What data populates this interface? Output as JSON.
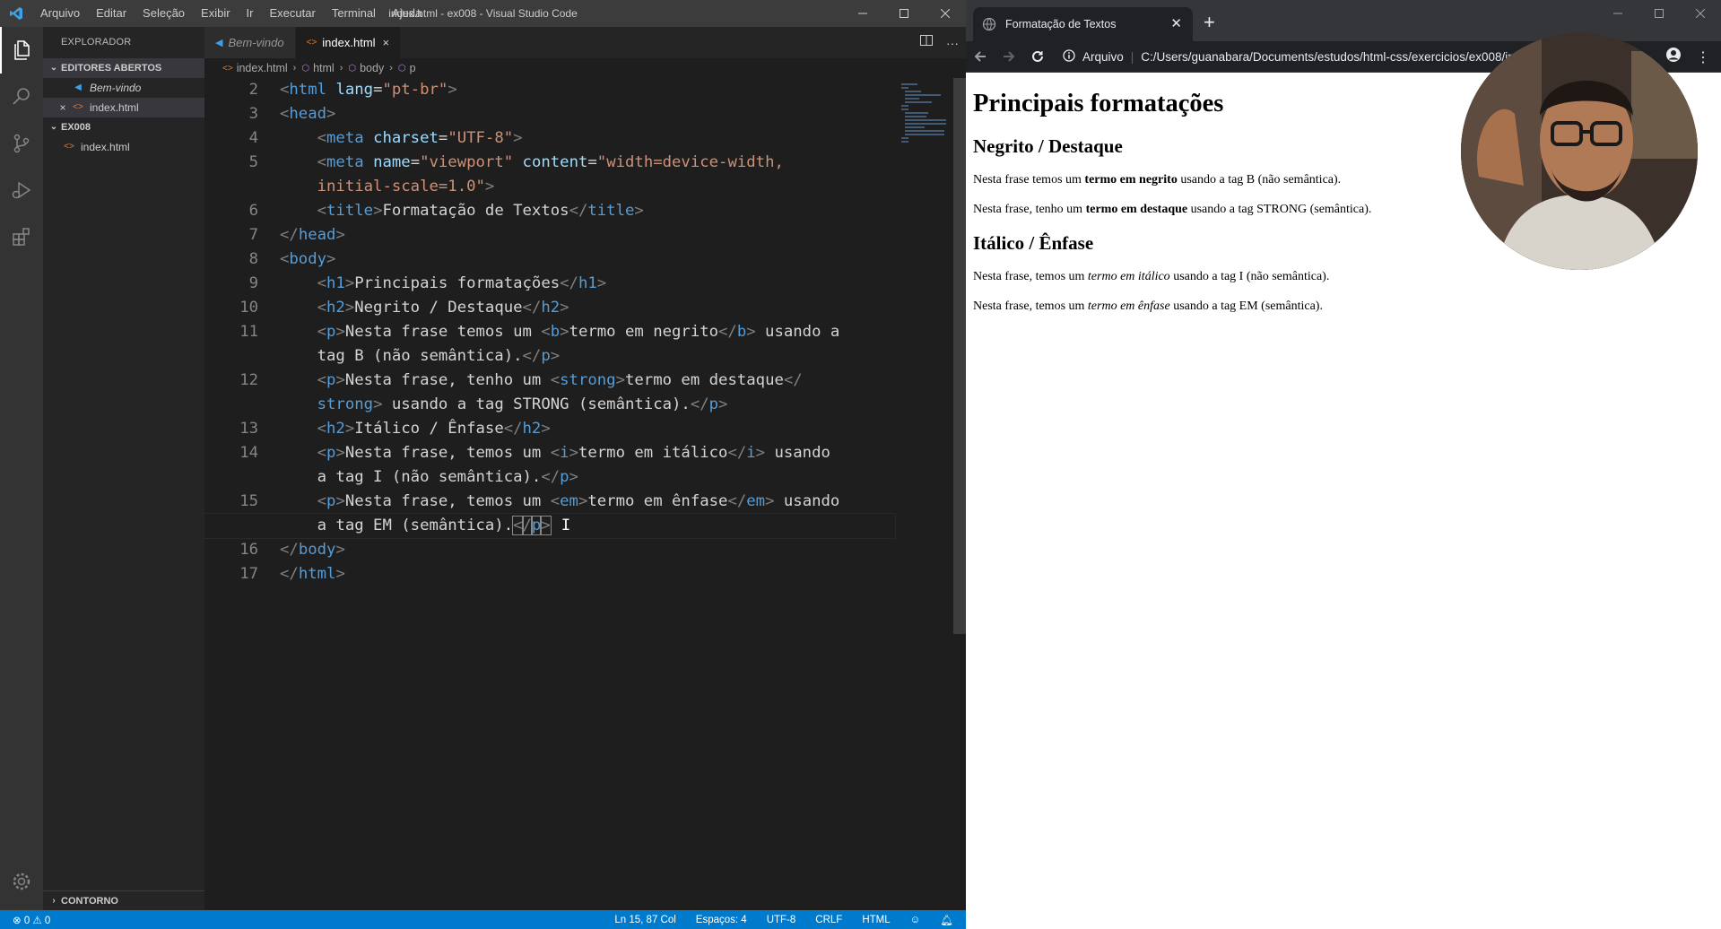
{
  "vscode": {
    "menu": [
      "Arquivo",
      "Editar",
      "Seleção",
      "Exibir",
      "Ir",
      "Executar",
      "Terminal",
      "Ajuda"
    ],
    "window_title": "index.html - ex008 - Visual Studio Code",
    "sidebar": {
      "title": "EXPLORADOR",
      "open_editors_label": "EDITORES ABERTOS",
      "open_editors": [
        {
          "label": "Bem-vindo",
          "icon": "vscode-icon"
        },
        {
          "label": "index.html",
          "icon": "html-file-icon",
          "close": "×"
        }
      ],
      "folder_label": "EX008",
      "folder_files": [
        "index.html"
      ],
      "outline_label": "CONTORNO"
    },
    "tabs": [
      {
        "label": "Bem-vindo",
        "active": false
      },
      {
        "label": "index.html",
        "active": true,
        "close": "×"
      }
    ],
    "breadcrumb": [
      "index.html",
      "html",
      "body",
      "p"
    ],
    "code_lines": [
      {
        "n": "2",
        "parts": [
          [
            "t",
            "<"
          ],
          [
            "tag",
            "html"
          ],
          [
            "txt",
            " "
          ],
          [
            "attr",
            "lang"
          ],
          [
            "txt",
            "="
          ],
          [
            "str",
            "\"pt-br\""
          ],
          [
            "t",
            ">"
          ]
        ]
      },
      {
        "n": "3",
        "parts": [
          [
            "t",
            "<"
          ],
          [
            "tag",
            "head"
          ],
          [
            "t",
            ">"
          ]
        ]
      },
      {
        "n": "4",
        "parts": [
          [
            "txt",
            "    "
          ],
          [
            "t",
            "<"
          ],
          [
            "tag",
            "meta"
          ],
          [
            "txt",
            " "
          ],
          [
            "attr",
            "charset"
          ],
          [
            "txt",
            "="
          ],
          [
            "str",
            "\"UTF-8\""
          ],
          [
            "t",
            ">"
          ]
        ]
      },
      {
        "n": "5",
        "parts": [
          [
            "txt",
            "    "
          ],
          [
            "t",
            "<"
          ],
          [
            "tag",
            "meta"
          ],
          [
            "txt",
            " "
          ],
          [
            "attr",
            "name"
          ],
          [
            "txt",
            "="
          ],
          [
            "str",
            "\"viewport\""
          ],
          [
            "txt",
            " "
          ],
          [
            "attr",
            "content"
          ],
          [
            "txt",
            "="
          ],
          [
            "str",
            "\"width=device-width,"
          ]
        ]
      },
      {
        "n": "",
        "parts": [
          [
            "txt",
            "    "
          ],
          [
            "str",
            "initial-scale=1.0\""
          ],
          [
            "t",
            ">"
          ]
        ]
      },
      {
        "n": "6",
        "parts": [
          [
            "txt",
            "    "
          ],
          [
            "t",
            "<"
          ],
          [
            "tag",
            "title"
          ],
          [
            "t",
            ">"
          ],
          [
            "txt",
            "Formatação de Textos"
          ],
          [
            "t",
            "</"
          ],
          [
            "tag",
            "title"
          ],
          [
            "t",
            ">"
          ]
        ]
      },
      {
        "n": "7",
        "parts": [
          [
            "t",
            "</"
          ],
          [
            "tag",
            "head"
          ],
          [
            "t",
            ">"
          ]
        ]
      },
      {
        "n": "8",
        "parts": [
          [
            "t",
            "<"
          ],
          [
            "tag",
            "body"
          ],
          [
            "t",
            ">"
          ]
        ]
      },
      {
        "n": "9",
        "parts": [
          [
            "txt",
            "    "
          ],
          [
            "t",
            "<"
          ],
          [
            "tag",
            "h1"
          ],
          [
            "t",
            ">"
          ],
          [
            "txt",
            "Principais formatações"
          ],
          [
            "t",
            "</"
          ],
          [
            "tag",
            "h1"
          ],
          [
            "t",
            ">"
          ]
        ]
      },
      {
        "n": "10",
        "parts": [
          [
            "txt",
            "    "
          ],
          [
            "t",
            "<"
          ],
          [
            "tag",
            "h2"
          ],
          [
            "t",
            ">"
          ],
          [
            "txt",
            "Negrito / Destaque"
          ],
          [
            "t",
            "</"
          ],
          [
            "tag",
            "h2"
          ],
          [
            "t",
            ">"
          ]
        ]
      },
      {
        "n": "11",
        "parts": [
          [
            "txt",
            "    "
          ],
          [
            "t",
            "<"
          ],
          [
            "tag",
            "p"
          ],
          [
            "t",
            ">"
          ],
          [
            "txt",
            "Nesta frase temos um "
          ],
          [
            "t",
            "<"
          ],
          [
            "tag",
            "b"
          ],
          [
            "t",
            ">"
          ],
          [
            "txt",
            "termo em negrito"
          ],
          [
            "t",
            "</"
          ],
          [
            "tag",
            "b"
          ],
          [
            "t",
            ">"
          ],
          [
            "txt",
            " usando a"
          ]
        ]
      },
      {
        "n": "",
        "parts": [
          [
            "txt",
            "    tag B (não semântica)."
          ],
          [
            "t",
            "</"
          ],
          [
            "tag",
            "p"
          ],
          [
            "t",
            ">"
          ]
        ]
      },
      {
        "n": "12",
        "parts": [
          [
            "txt",
            "    "
          ],
          [
            "t",
            "<"
          ],
          [
            "tag",
            "p"
          ],
          [
            "t",
            ">"
          ],
          [
            "txt",
            "Nesta frase, tenho um "
          ],
          [
            "t",
            "<"
          ],
          [
            "tag",
            "strong"
          ],
          [
            "t",
            ">"
          ],
          [
            "txt",
            "termo em destaque"
          ],
          [
            "t",
            "</"
          ]
        ]
      },
      {
        "n": "",
        "parts": [
          [
            "txt",
            "    "
          ],
          [
            "tag",
            "strong"
          ],
          [
            "t",
            ">"
          ],
          [
            "txt",
            " usando a tag STRONG (semântica)."
          ],
          [
            "t",
            "</"
          ],
          [
            "tag",
            "p"
          ],
          [
            "t",
            ">"
          ]
        ]
      },
      {
        "n": "13",
        "parts": [
          [
            "txt",
            "    "
          ],
          [
            "t",
            "<"
          ],
          [
            "tag",
            "h2"
          ],
          [
            "t",
            ">"
          ],
          [
            "txt",
            "Itálico / Ênfase"
          ],
          [
            "t",
            "</"
          ],
          [
            "tag",
            "h2"
          ],
          [
            "t",
            ">"
          ]
        ]
      },
      {
        "n": "14",
        "parts": [
          [
            "txt",
            "    "
          ],
          [
            "t",
            "<"
          ],
          [
            "tag",
            "p"
          ],
          [
            "t",
            ">"
          ],
          [
            "txt",
            "Nesta frase, temos um "
          ],
          [
            "t",
            "<"
          ],
          [
            "tag",
            "i"
          ],
          [
            "t",
            ">"
          ],
          [
            "txt",
            "termo em itálico"
          ],
          [
            "t",
            "</"
          ],
          [
            "tag",
            "i"
          ],
          [
            "t",
            ">"
          ],
          [
            "txt",
            " usando"
          ]
        ]
      },
      {
        "n": "",
        "parts": [
          [
            "txt",
            "    a tag I (não semântica)."
          ],
          [
            "t",
            "</"
          ],
          [
            "tag",
            "p"
          ],
          [
            "t",
            ">"
          ]
        ]
      },
      {
        "n": "15",
        "parts": [
          [
            "txt",
            "    "
          ],
          [
            "t",
            "<"
          ],
          [
            "tag",
            "p"
          ],
          [
            "t",
            ">"
          ],
          [
            "txt",
            "Nesta frase, temos um "
          ],
          [
            "t",
            "<"
          ],
          [
            "tag",
            "em"
          ],
          [
            "t",
            ">"
          ],
          [
            "txt",
            "termo em ênfase"
          ],
          [
            "t",
            "</"
          ],
          [
            "tag",
            "em"
          ],
          [
            "t",
            ">"
          ],
          [
            "txt",
            " usando"
          ]
        ]
      },
      {
        "n": "",
        "cur": true,
        "parts": [
          [
            "txt",
            "    a tag EM (semântica)."
          ],
          [
            "t",
            "<"
          ],
          [
            "t",
            "/"
          ],
          [
            "tag",
            "p"
          ],
          [
            "t",
            ">"
          ]
        ]
      },
      {
        "n": "16",
        "parts": [
          [
            "t",
            "</"
          ],
          [
            "tag",
            "body"
          ],
          [
            "t",
            ">"
          ]
        ]
      },
      {
        "n": "17",
        "parts": [
          [
            "t",
            "</"
          ],
          [
            "tag",
            "html"
          ],
          [
            "t",
            ">"
          ]
        ]
      }
    ],
    "status": {
      "errors": "⊗ 0 ⚠ 0",
      "position": "Ln 15, 87 Col",
      "spaces": "Espaços: 4",
      "encoding": "UTF-8",
      "eol": "CRLF",
      "language": "HTML"
    },
    "colors": {
      "accent": "#007acc",
      "tag": "#569cd6",
      "attr": "#9cdcfe",
      "string": "#ce9178"
    }
  },
  "chrome": {
    "tab_title": "Formatação de Textos",
    "new_tab": "+",
    "omnibox_label": "Arquivo",
    "url": "C:/Users/guanabara/Documents/estudos/html-css/exercicios/ex008/index.html",
    "page": {
      "h1": "Principais formatações",
      "h2_1": "Negrito / Destaque",
      "p1_pre": "Nesta frase temos um ",
      "p1_b": "termo em negrito",
      "p1_post": " usando a tag B (não semântica).",
      "p2_pre": "Nesta frase, tenho um ",
      "p2_b": "termo em destaque",
      "p2_post": " usando a tag STRONG (semântica).",
      "h2_2": "Itálico / Ênfase",
      "p3_pre": "Nesta frase, temos um ",
      "p3_i": "termo em itálico",
      "p3_post": " usando a tag I (não semântica).",
      "p4_pre": "Nesta frase, temos um ",
      "p4_i": "termo em ênfase",
      "p4_post": " usando a tag EM (semântica)."
    }
  }
}
